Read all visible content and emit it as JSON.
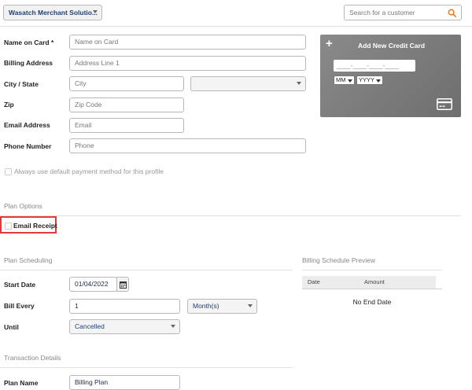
{
  "header": {
    "merchant_select": "Wasatch Merchant Solutio...",
    "search_placeholder": "Search for a customer"
  },
  "card_form": {
    "name_label": "Name on Card *",
    "name_placeholder": "Name on Card",
    "billing_label": "Billing Address",
    "billing_placeholder": "Address Line 1",
    "city_state_label": "City / State",
    "city_placeholder": "City",
    "state_value": "",
    "zip_label": "Zip",
    "zip_placeholder": "Zip Code",
    "email_label": "Email Address",
    "email_placeholder": "Email",
    "phone_label": "Phone Number",
    "phone_placeholder": "Phone",
    "default_payment_label": "Always use default payment method for this profile"
  },
  "credit_card_panel": {
    "title": "Add New Credit Card",
    "number_placeholder": "____-____-____-____",
    "month_value": "MM",
    "year_value": "YYYY",
    "bg_color": "#7d7d7d"
  },
  "plan_options": {
    "title": "Plan Options",
    "email_receipt_label": "Email Receipt",
    "highlight_color": "#e53935"
  },
  "plan_scheduling": {
    "title": "Plan Scheduling",
    "start_date_label": "Start Date",
    "start_date_value": "01/04/2022",
    "bill_every_label": "Bill Every",
    "bill_every_value": "1",
    "period_value": "Month(s)",
    "until_label": "Until",
    "until_value": "Cancelled"
  },
  "billing_preview": {
    "title": "Billing Schedule Preview",
    "columns": [
      "Date",
      "Amount"
    ],
    "empty_text": "No End Date"
  },
  "transaction_details": {
    "title": "Transaction Details",
    "plan_name_label": "Plan Name",
    "plan_name_value": "Billing Plan"
  }
}
